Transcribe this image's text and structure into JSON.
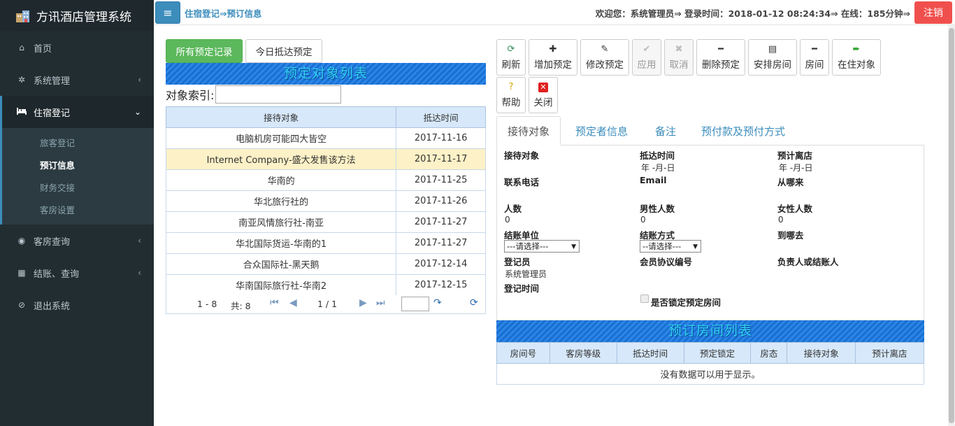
{
  "app": {
    "title": "方讯酒店管理系统"
  },
  "sidebar": {
    "items": [
      {
        "label": "首页",
        "icon": "home-icon"
      },
      {
        "label": "系统管理",
        "icon": "gear-icon"
      },
      {
        "label": "住宿登记",
        "icon": "bed-icon"
      },
      {
        "label": "客房查询",
        "icon": "eye-icon"
      },
      {
        "label": "结账、查询",
        "icon": "calculator-icon"
      },
      {
        "label": "退出系统",
        "icon": "ban-icon"
      }
    ],
    "submenu": [
      "旅客登记",
      "预订信息",
      "财务交接",
      "客房设置"
    ]
  },
  "header": {
    "breadcrumb": "住宿登记⇒预订信息",
    "welcome": "欢迎您：系统管理员⇒ 登录时间：2018-01-12 08:24:34⇒ 在线：185分钟⇒",
    "logout": "注销"
  },
  "left": {
    "tab_all": "所有预定记录",
    "tab_today": "今日抵达预定",
    "list_title": "预定对象列表",
    "index_label": "对象索引:",
    "columns": [
      "接待对象",
      "抵达时间"
    ],
    "rows": [
      [
        "电脑机房可能四大皆空",
        "2017-11-16"
      ],
      [
        "Internet Company-盛大发售该方法",
        "2017-11-17"
      ],
      [
        "华南的",
        "2017-11-25"
      ],
      [
        "华北旅行社的",
        "2017-11-26"
      ],
      [
        "南亚风情旅行社-南亚",
        "2017-11-27"
      ],
      [
        "华北国际货运-华南的1",
        "2017-11-27"
      ],
      [
        "合众国际社-黑天鹅",
        "2017-12-14"
      ],
      [
        "华南国际旅行社-华南2",
        "2017-12-15"
      ]
    ],
    "pager": {
      "range": "1 - 8",
      "total": "共: 8",
      "page": "1 / 1"
    }
  },
  "toolbar": {
    "refresh": "刷新",
    "add": "增加预定",
    "edit": "修改预定",
    "apply": "应用",
    "cancel": "取消",
    "delete": "删除预定",
    "arrange": "安排房间",
    "room": "房间",
    "occupant": "在住对象",
    "help": "帮助",
    "close": "关闭"
  },
  "detail": {
    "tabs": [
      "接待对象",
      "预定者信息",
      "备注",
      "预付款及预付方式"
    ],
    "fields": {
      "receive_obj": "接待对象",
      "arrival_time": "抵达时间",
      "arrival_value": " 年 -月-日",
      "departure": "预计离店",
      "departure_value": " 年 -月-日",
      "phone": "联系电话",
      "email": "Email",
      "from_where": "从哪来",
      "people": "人数",
      "people_value": "0",
      "male": "男性人数",
      "male_value": "0",
      "female": "女性人数",
      "female_value": "0",
      "settle_unit": "结账单位",
      "settle_unit_value": "---请选择---",
      "settle_method": "结账方式",
      "settle_method_value": "--请选择---",
      "to_where": "到哪去",
      "registrar": "登记员",
      "registrar_value": "系统管理员",
      "member_no": "会员协议编号",
      "responsible": "负责人或结账人",
      "reg_time": "登记时间",
      "lock_room": "是否锁定预定房间"
    }
  },
  "rooms": {
    "title": "预订房间列表",
    "columns": [
      "房间号",
      "客房等级",
      "抵达时间",
      "预定锁定",
      "房态",
      "接待对象",
      "预计离店"
    ],
    "empty": "没有数据可以用于显示。"
  }
}
